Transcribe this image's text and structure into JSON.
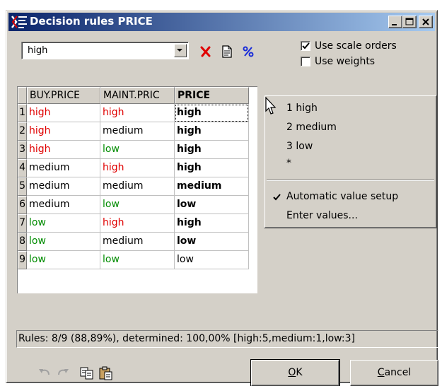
{
  "window": {
    "title": "Decision rules PRICE"
  },
  "toolbar": {
    "combo_value": "high",
    "use_scale_orders": {
      "label": "Use scale orders",
      "checked": true
    },
    "use_weights": {
      "label": "Use weights",
      "checked": false
    }
  },
  "grid": {
    "columns": [
      "BUY.PRICE",
      "MAINT.PRIC",
      "PRICE"
    ],
    "rows": [
      {
        "n": "1",
        "buy": "high",
        "maint": "high",
        "price": "high"
      },
      {
        "n": "2",
        "buy": "high",
        "maint": "medium",
        "price": "high"
      },
      {
        "n": "3",
        "buy": "high",
        "maint": "low",
        "price": "high"
      },
      {
        "n": "4",
        "buy": "medium",
        "maint": "high",
        "price": "high"
      },
      {
        "n": "5",
        "buy": "medium",
        "maint": "medium",
        "price": "medium"
      },
      {
        "n": "6",
        "buy": "medium",
        "maint": "low",
        "price": "low"
      },
      {
        "n": "7",
        "buy": "low",
        "maint": "high",
        "price": "high"
      },
      {
        "n": "8",
        "buy": "low",
        "maint": "medium",
        "price": "low"
      },
      {
        "n": "9",
        "buy": "low",
        "maint": "low",
        "price": "low"
      }
    ]
  },
  "menu": {
    "items": [
      "1 high",
      "2 medium",
      "3 low",
      "*"
    ],
    "auto_setup": "Automatic value setup",
    "enter_values": "Enter values..."
  },
  "status": "Rules: 8/9 (88,89%), determined: 100,00% [high:5,medium:1,low:3]",
  "buttons": {
    "ok_u": "O",
    "ok_rest": "K",
    "cancel_u": "C",
    "cancel_rest": "ancel"
  },
  "colors": {
    "high": "#e00000",
    "medium": "#000000",
    "low": "#008c00"
  }
}
